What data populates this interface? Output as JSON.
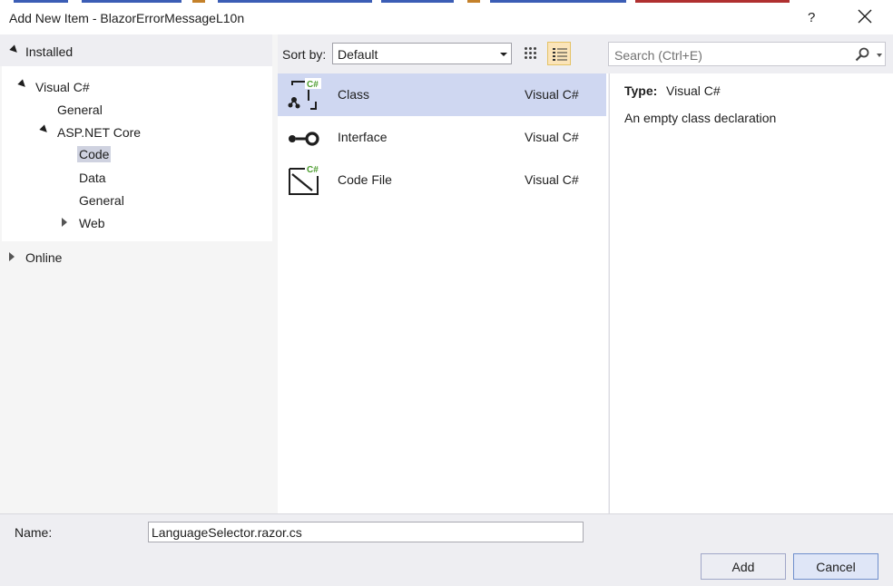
{
  "dialog": {
    "title": "Add New Item - BlazorErrorMessageL10n",
    "help_label": "?"
  },
  "tree": {
    "installed_label": "Installed",
    "visual_csharp": "Visual C#",
    "general": "General",
    "asp_net_core": "ASP.NET Core",
    "code": "Code",
    "data": "Data",
    "general2": "General",
    "web": "Web",
    "online_label": "Online"
  },
  "sort": {
    "label": "Sort by:",
    "value": "Default"
  },
  "items": [
    {
      "name": "Class",
      "type": "Visual C#",
      "icon": "class-icon",
      "selected": true
    },
    {
      "name": "Interface",
      "type": "Visual C#",
      "icon": "interface-icon",
      "selected": false
    },
    {
      "name": "Code File",
      "type": "Visual C#",
      "icon": "code-file-icon",
      "selected": false
    }
  ],
  "search": {
    "placeholder": "Search (Ctrl+E)"
  },
  "details": {
    "type_label": "Type:",
    "type_value": "Visual C#",
    "description": "An empty class declaration"
  },
  "name_field": {
    "label": "Name:",
    "value": "LanguageSelector.razor.cs"
  },
  "buttons": {
    "add": "Add",
    "cancel": "Cancel"
  },
  "colors": {
    "selection": "#cfd7f1",
    "accent_green": "#4c9c2e",
    "view_active": "#fbe4b9"
  }
}
